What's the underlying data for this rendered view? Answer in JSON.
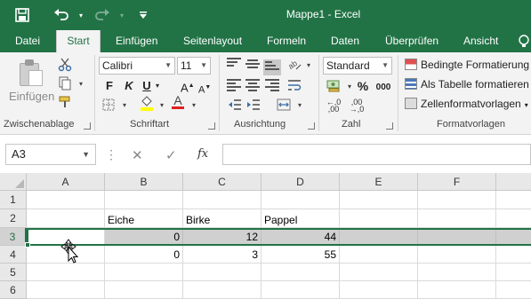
{
  "titlebar": {
    "title": "Mappe1 - Excel",
    "save_icon": "save-icon",
    "undo_icon": "undo-icon",
    "redo_icon": "redo-icon",
    "qat_icon": "customize-qat-icon"
  },
  "tabs": [
    {
      "label": "Datei",
      "active": false
    },
    {
      "label": "Start",
      "active": true
    },
    {
      "label": "Einfügen",
      "active": false
    },
    {
      "label": "Seitenlayout",
      "active": false
    },
    {
      "label": "Formeln",
      "active": false
    },
    {
      "label": "Daten",
      "active": false
    },
    {
      "label": "Überprüfen",
      "active": false
    },
    {
      "label": "Ansicht",
      "active": false
    }
  ],
  "ribbon": {
    "clipboard": {
      "group_label": "Zwischenablage",
      "paste_label": "Einfügen"
    },
    "font": {
      "group_label": "Schriftart",
      "font_name": "Calibri",
      "font_size": "11",
      "bold": "F",
      "italic": "K",
      "underline": "U",
      "grow": "A",
      "shrink": "A",
      "font_color_letter": "A"
    },
    "alignment": {
      "group_label": "Ausrichtung"
    },
    "number": {
      "group_label": "Zahl",
      "format": "Standard",
      "percent": "%",
      "thousands": "000"
    },
    "styles": {
      "group_label": "Formatvorlagen",
      "conditional": "Bedingte Formatierung",
      "as_table": "Als Tabelle formatieren",
      "cell_styles": "Zellenformatvorlagen"
    }
  },
  "formula_bar": {
    "name_box": "A3",
    "fx": "fx",
    "value": ""
  },
  "grid": {
    "columns": [
      "A",
      "B",
      "C",
      "D",
      "E",
      "F"
    ],
    "rows": [
      "1",
      "2",
      "3",
      "4",
      "5",
      "6"
    ],
    "selected_row": "3",
    "cells": {
      "B2": "Eiche",
      "C2": "Birke",
      "D2": "Pappel",
      "B3": "0",
      "C3": "12",
      "D3": "44",
      "B4": "0",
      "C4": "3",
      "D4": "55"
    }
  },
  "colors": {
    "accent": "#217346",
    "ribbon_bg": "#f3f3f3",
    "selection_bg": "#d0d0d0"
  }
}
